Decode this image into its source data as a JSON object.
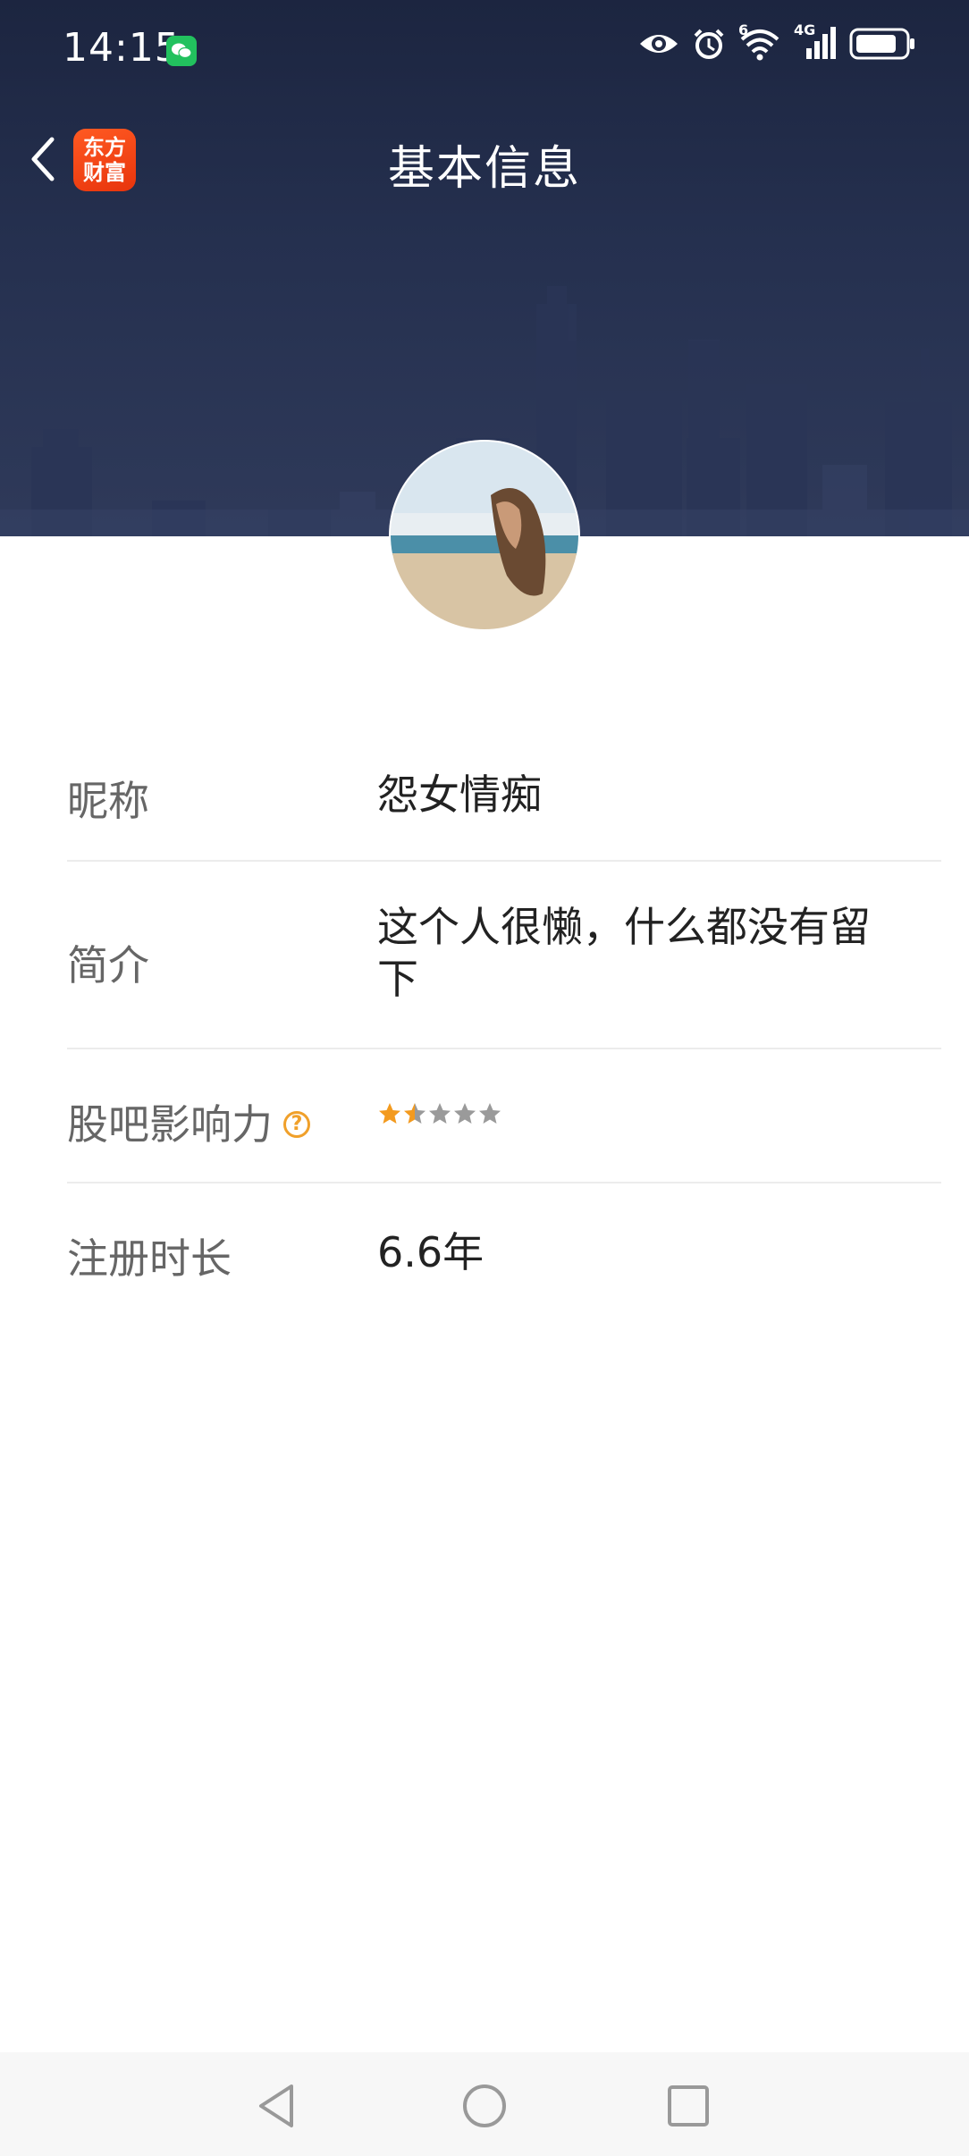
{
  "status_bar": {
    "time": "14:15",
    "icons": [
      "wechat-icon",
      "eye-icon",
      "alarm-icon",
      "wifi-icon",
      "signal-4g-icon",
      "battery-icon"
    ],
    "wifi_badge": "6",
    "network_label": "4G"
  },
  "header": {
    "title": "基本信息",
    "app_logo_line1": "东方",
    "app_logo_line2": "财富"
  },
  "profile": {
    "nickname_label": "昵称",
    "nickname": "怨女情痴",
    "bio_label": "简介",
    "bio": "这个人很懒，什么都没有留下",
    "influence_label": "股吧影响力",
    "influence_help": "?",
    "influence_rating": 1.5,
    "influence_max": 5,
    "registration_label": "注册时长",
    "registration_value": "6.6年"
  },
  "colors": {
    "header_bg": "#25304f",
    "star_active": "#f39a1e",
    "star_inactive": "#9a9a9a",
    "logo_bg": "#f04a18"
  }
}
